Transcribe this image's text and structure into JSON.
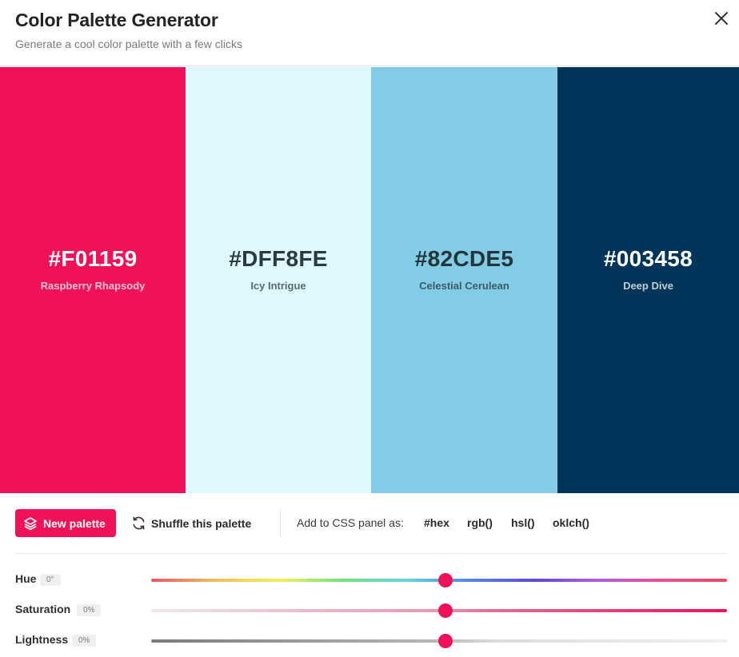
{
  "header": {
    "title": "Color Palette Generator",
    "subtitle": "Generate a cool color palette with a few clicks"
  },
  "palette": [
    {
      "hex": "#F01159",
      "name": "Raspberry Rhapsody",
      "bg": "#F01159",
      "text_color": "#ffffff"
    },
    {
      "hex": "#DFF8FE",
      "name": "Icy Intrigue",
      "bg": "#DFF8FE",
      "text_color": "#2b3a40"
    },
    {
      "hex": "#82CDE5",
      "name": "Celestial Cerulean",
      "bg": "#82CDE5",
      "text_color": "#22343c"
    },
    {
      "hex": "#003458",
      "name": "Deep Dive",
      "bg": "#003458",
      "text_color": "#ffffff"
    }
  ],
  "toolbar": {
    "new_palette_label": "New palette",
    "shuffle_label": "Shuffle this palette",
    "css_panel_label": "Add to CSS panel as:",
    "formats": [
      "#hex",
      "rgb()",
      "hsl()",
      "oklch()"
    ]
  },
  "sliders": {
    "hue": {
      "label": "Hue",
      "value": "0°",
      "level": 0.5
    },
    "saturation": {
      "label": "Saturation",
      "value": "0%",
      "level": 0.5
    },
    "lightness": {
      "label": "Lightness",
      "value": "0%",
      "level": 0.5
    }
  },
  "colors": {
    "accent": "#F01159"
  }
}
